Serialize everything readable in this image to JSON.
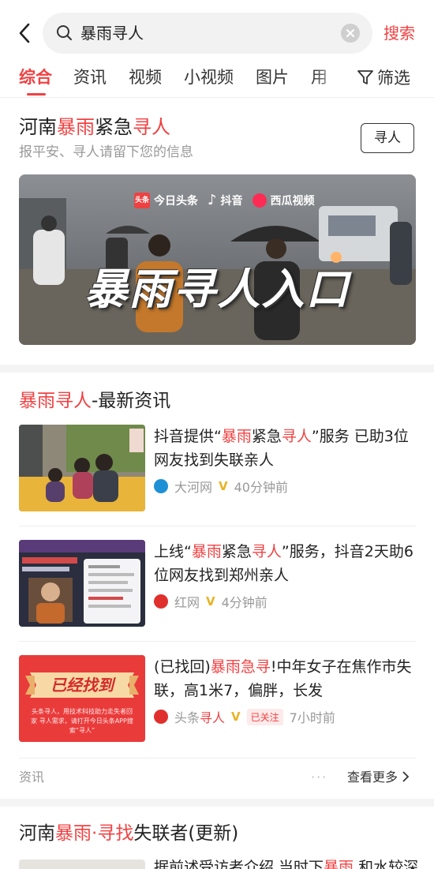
{
  "search": {
    "query": "暴雨寻人",
    "button": "搜索"
  },
  "tabs": [
    {
      "label": "综合",
      "active": true
    },
    {
      "label": "资讯"
    },
    {
      "label": "视频"
    },
    {
      "label": "小视频"
    },
    {
      "label": "图片"
    },
    {
      "label": "用"
    }
  ],
  "filter_label": "筛选",
  "card1": {
    "title_pre": "河南",
    "title_hl1": "暴雨",
    "title_mid": "紧急",
    "title_hl2": "寻人",
    "subtitle": "报平安、寻人请留下您的信息",
    "button": "寻人",
    "banner": {
      "logos": [
        "头条",
        "今日头条",
        "抖音",
        "西瓜视频"
      ],
      "title": "暴雨寻人入口"
    }
  },
  "news_section": {
    "title_hl": "暴雨寻人",
    "title_rest": "-最新资讯",
    "items": [
      {
        "t1": "抖音提供“",
        "h1": "暴雨",
        "t2": "紧急",
        "h2": "寻人",
        "t3": "”服务 已助3位网友找到失联亲人",
        "source": "大河网",
        "verified": "V",
        "time": "40分钟前",
        "icon_color": "#1e90d6"
      },
      {
        "t1": "上线“",
        "h1": "暴雨",
        "t2": "紧急",
        "h2": "寻人",
        "t3": "”服务，抖音2天助6位网友找到郑州亲人",
        "source": "红网",
        "verified": "V",
        "time": "4分钟前",
        "icon_color": "#e0302e"
      },
      {
        "t1": "(已找回)",
        "h1": "暴雨急寻",
        "t2": "!中年女子在焦作市失联，高1米7，偏胖，长发",
        "h2": "",
        "t3": "",
        "source": "头条",
        "source_hl": "寻人",
        "verified": "V",
        "follow": "已关注",
        "time": "7小时前",
        "icon_color": "#e0302e",
        "thumb_text": "已经找到",
        "thumb_small": "头条寻人，用技术科技助力走失者回家 寻人需求，请打开今日头条APP搜索“寻人”"
      }
    ],
    "footer_label": "资讯",
    "more": "查看更多"
  },
  "card3": {
    "t1": "河南",
    "h1": "暴雨",
    "t2": "·",
    "h2": "寻找",
    "t3": "失联者(更新)",
    "preview_t1": "据前述受访者介绍 当时下",
    "preview_h1": "暴雨",
    "preview_t2": " 和水较深"
  },
  "colors": {
    "accent": "#f04142",
    "muted": "#999999",
    "text": "#222222"
  }
}
